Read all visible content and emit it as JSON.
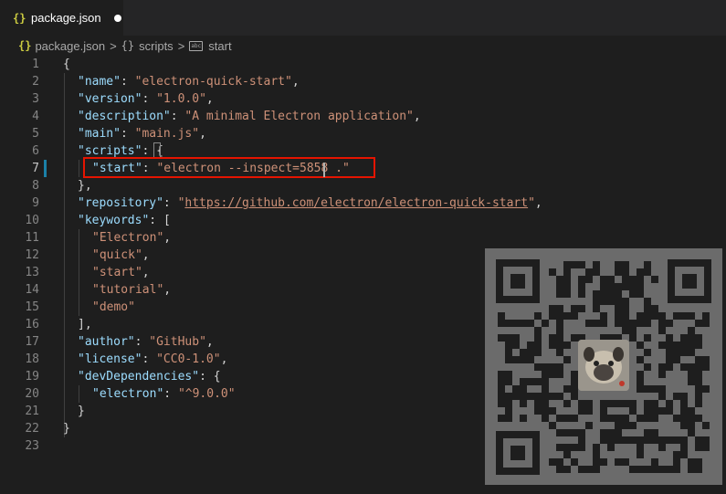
{
  "tab": {
    "icon": "json-braces-icon",
    "label": "package.json",
    "modified_indicator": "dirty-dot"
  },
  "breadcrumb": {
    "items": [
      {
        "icon": "json-braces-icon",
        "label": "package.json"
      },
      {
        "icon": "object-braces-icon",
        "label": "scripts"
      },
      {
        "icon": "string-icon",
        "label": "start"
      }
    ],
    "icon_text": {
      "json": "{}",
      "object": "{}",
      "string": "abc"
    },
    "separator": ">"
  },
  "editor": {
    "active_line": 7,
    "line_numbers": [
      "1",
      "2",
      "3",
      "4",
      "5",
      "6",
      "7",
      "8",
      "9",
      "10",
      "11",
      "12",
      "13",
      "14",
      "15",
      "16",
      "17",
      "18",
      "19",
      "20",
      "21",
      "22",
      "23"
    ],
    "lines": {
      "l1": {
        "p": "{"
      },
      "l2": {
        "k": "\"name\"",
        "sep": ": ",
        "v": "\"electron-quick-start\"",
        "end": ","
      },
      "l3": {
        "k": "\"version\"",
        "sep": ": ",
        "v": "\"1.0.0\"",
        "end": ","
      },
      "l4": {
        "k": "\"description\"",
        "sep": ": ",
        "v": "\"A minimal Electron application\"",
        "end": ","
      },
      "l5": {
        "k": "\"main\"",
        "sep": ": ",
        "v": "\"main.js\"",
        "end": ","
      },
      "l6": {
        "k": "\"scripts\"",
        "sep": ": ",
        "v": "{"
      },
      "l7": {
        "k": "\"start\"",
        "sep": ": ",
        "v": "\"electron --inspect=5858 .\""
      },
      "l8": {
        "p": "},"
      },
      "l9": {
        "k": "\"repository\"",
        "sep": ": ",
        "q1": "\"",
        "url": "https://github.com/electron/electron-quick-start",
        "q2": "\"",
        "end": ","
      },
      "l10": {
        "k": "\"keywords\"",
        "sep": ": ",
        "v": "["
      },
      "l11": {
        "v": "\"Electron\"",
        "end": ","
      },
      "l12": {
        "v": "\"quick\"",
        "end": ","
      },
      "l13": {
        "v": "\"start\"",
        "end": ","
      },
      "l14": {
        "v": "\"tutorial\"",
        "end": ","
      },
      "l15": {
        "v": "\"demo\""
      },
      "l16": {
        "p": "],"
      },
      "l17": {
        "k": "\"author\"",
        "sep": ": ",
        "v": "\"GitHub\"",
        "end": ","
      },
      "l18": {
        "k": "\"license\"",
        "sep": ": ",
        "v": "\"CC0-1.0\"",
        "end": ","
      },
      "l19": {
        "k": "\"devDependencies\"",
        "sep": ": ",
        "v": "{"
      },
      "l20": {
        "k": "\"electron\"",
        "sep": ": ",
        "v": "\"^9.0.0\""
      },
      "l21": {
        "p": "}"
      },
      "l22": {
        "p": "}"
      },
      "l23": {
        "p": ""
      }
    }
  },
  "overlay": {
    "qr_code": "qr-code-image",
    "avatar": "pug-avatar"
  },
  "colors": {
    "key": "#9cdcfe",
    "string": "#ce9178",
    "punctuation": "#d4d4d4",
    "highlight_border": "#e51400",
    "modified_gutter": "#1b81a8"
  }
}
